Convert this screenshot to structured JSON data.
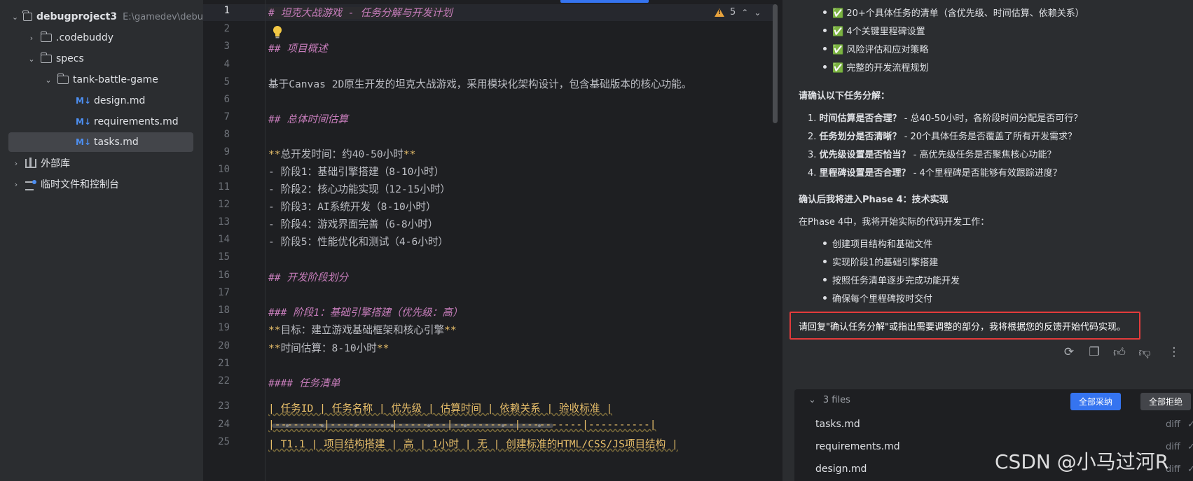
{
  "sidebar": {
    "project_name": "debugproject3",
    "project_path": "E:\\gamedev\\debu",
    "folders": {
      "codebuddy": ".codebuddy",
      "specs": "specs",
      "tank": "tank-battle-game"
    },
    "files": [
      "design.md",
      "requirements.md",
      "tasks.md"
    ],
    "md_badge": "M↓",
    "external_libs": "外部库",
    "scratches": "临时文件和控制台"
  },
  "editor": {
    "warning_count": "5",
    "line_numbers": [
      "1",
      "2",
      "3",
      "4",
      "5",
      "6",
      "7",
      "8",
      "9",
      "10",
      "11",
      "12",
      "13",
      "14",
      "15",
      "16",
      "17",
      "18",
      "19",
      "20",
      "21",
      "22",
      "23",
      "24",
      "25"
    ],
    "lines": {
      "l1": "# 坦克大战游戏 - 任务分解与开发计划",
      "l3": "## 项目概述",
      "l5": "基于Canvas 2D原生开发的坦克大战游戏，采用模块化架构设计，包含基础版本的核心功能。",
      "l7": "## 总体时间估算",
      "l9_a": "**",
      "l9_b": "总开发时间：约40-50小时",
      "l9_c": "**",
      "l10": "- 阶段1：基础引擎搭建（8-10小时）",
      "l11": "- 阶段2：核心功能实现（12-15小时）",
      "l12": "- 阶段3：AI系统开发（8-10小时）",
      "l13": "- 阶段4：游戏界面完善（6-8小时）",
      "l14": "- 阶段5：性能优化和测试（4-6小时）",
      "l16": "## 开发阶段划分",
      "l18": "### 阶段1：基础引擎搭建（优先级：高）",
      "l19_a": "**",
      "l19_b": "目标：建立游戏基础框架和核心引擎",
      "l19_c": "**",
      "l20_a": "**",
      "l20_b": "时间估算：8-10小时",
      "l20_c": "**",
      "l22": "#### 任务清单",
      "l23": "| 任务ID | 任务名称 | 优先级 | 估算时间 | 依赖关系 | 验收标准 |",
      "l24": "|--------|----------|--------|----------|----------|----------|",
      "l25": "| T1.1 | 项目结构搭建 | 高 | 1小时 | 无 | 创建标准的HTML/CSS/JS项目结构 |"
    }
  },
  "chat": {
    "top_bullets": [
      "✅ 20+个具体任务的清单（含优先级、时间估算、依赖关系）",
      "✅ 4个关键里程碑设置",
      "✅ 风险评估和应对策略",
      "✅ 完整的开发流程规划"
    ],
    "confirm_heading": "请确认以下任务分解：",
    "questions": [
      {
        "num": "1.",
        "bold": "时间估算是否合理？",
        "rest": " - 总40-50小时，各阶段时间分配是否可行？"
      },
      {
        "num": "2.",
        "bold": "任务划分是否清晰？",
        "rest": " - 20个具体任务是否覆盖了所有开发需求？"
      },
      {
        "num": "3.",
        "bold": "优先级设置是否恰当？",
        "rest": " - 高优先级任务是否聚焦核心功能？"
      },
      {
        "num": "4.",
        "bold": "里程碑设置是否合理？",
        "rest": " - 4个里程碑是否能够有效跟踪进度？"
      }
    ],
    "phase_heading": "确认后我将进入Phase 4：技术实现",
    "phase_intro": "在Phase 4中，我将开始实际的代码开发工作：",
    "phase_bullets": [
      "创建项目结构和基础文件",
      "实现阶段1的基础引擎搭建",
      "按照任务清单逐步完成功能开发",
      "确保每个里程碑按时交付"
    ],
    "reply_prompt": "请回复\"确认任务分解\"或指出需要调整的部分，我将根据您的反馈开始代码实现。",
    "files_count": "3 files",
    "accept_all": "全部采纳",
    "reject_all": "全部拒绝",
    "changed_files": [
      "tasks.md",
      "requirements.md",
      "design.md"
    ],
    "diff_label": "diff",
    "accept_glyph": "✓",
    "reject_glyph": "X"
  },
  "watermark": "CSDN @小马过河R",
  "colors": {
    "accent": "#3574f0",
    "highlight_border": "#e33b3b",
    "warning": "#e8a33d",
    "heading": "#c77dbb",
    "bold_marker": "#e8bf6a"
  }
}
